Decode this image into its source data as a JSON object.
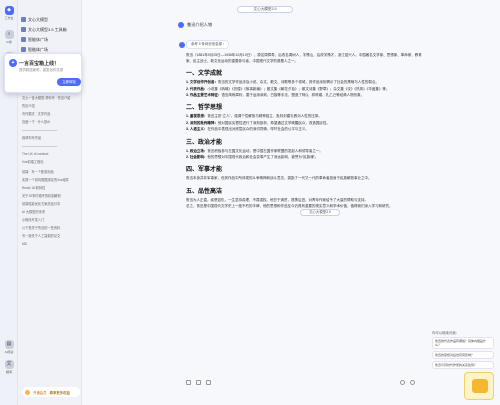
{
  "rail": {
    "items": [
      {
        "label": "工作台"
      },
      {
        "label": "AI搜"
      },
      {
        "label": "AI写作"
      },
      {
        "label": "AI阅读"
      },
      {
        "label": "翻译"
      }
    ]
  },
  "sidebar": {
    "nav": [
      {
        "label": "文心大模型",
        "icon": "chat-icon"
      },
      {
        "label": "文心大模型3.5 工具箱",
        "icon": "tool-icon"
      },
      {
        "label": "智能体广场",
        "icon": "agent-icon"
      },
      {
        "label": "智能体广场",
        "icon": "agent-icon"
      }
    ],
    "history": [
      "文心一言大模型 帮你写 · 鲁迅介绍",
      "鲁迅介绍",
      "写作模式 · 文学作品",
      "百度一下 · 什么是AI",
      "———————————",
      "我帮你写作品",
      "———————————",
      "The UX of conduct",
      "Vue前端工程化",
      "前端 · 写一个登录页面",
      "实现一个双向数据绑定的Vue组件",
      "React 18 新特性",
      "关于JS事件循环的机制解析",
      "前端性能优化方案总结分享",
      "AI 大模型的未来",
      "小程序开发入门",
      "以下是关于鲁迅的一些资料",
      "写一篇关于人工智能的论文",
      "MD"
    ],
    "popup": {
      "title": "一言百宝箱上线！",
      "subtitle": "提供精选案例，激发创作灵感",
      "button": "立即体验"
    },
    "bottom": {
      "text": "开通会员",
      "vip": "尊享更多权益"
    }
  },
  "main": {
    "top_pill": "文心大模型3.5",
    "user_prompt": "鲁迅介绍人物",
    "search_chip": "参考 8 条网页信息源 ›",
    "intro": "鲁迅（1881年9月25日—1936年10月19日），原名周樟寿，后改名周树人，字豫山，后改字豫才，浙江绍兴人。中国著名文学家、思想家、革命家、教育家、民主战士，新文化运动的重要参与者，中国现代文学的奠基人之一。",
    "sections": [
      {
        "title": "一、文学成就",
        "bullets": [
          {
            "k": "1. 文学创作开创者：",
            "v": "鲁迅的文学作品涉及小说、杂文、散文、诗歌等多个领域，其作品深刻揭示了社会的黑暗与人性的弱点。"
          },
          {
            "k": "2. 代表作品：",
            "v": "小说集《呐喊》《彷徨》《故事新编》；散文集《朝花夕拾》；散文诗集《野草》；杂文集《坟》《热风》《华盖集》等。"
          },
          {
            "k": "3. 作品主要艺术特征：",
            "v": "语言简练犀利，善于运用讽刺、白描等手法，塑造了阿Q、祥林嫂、孔乙己等经典人物形象。"
          }
        ]
      },
      {
        "title": "二、哲学思想",
        "bullets": [
          {
            "k": "1. 重视思想：",
            "v": "鲁迅主张“立人”，强调个性解放与精神独立，批判封建礼教对人性的压抑。"
          },
          {
            "k": "2. 深刻的批判精神：",
            "v": "他对国民劣根性进行了深刻剖析，希望通过文学唤醒民众，改造国民性。"
          },
          {
            "k": "3. 人道主义：",
            "v": "在作品中表现出对底层民众的深切同情，呼吁社会的公平与正义。"
          }
        ]
      },
      {
        "title": "三、政治才能",
        "bullets": [
          {
            "k": "1. 政治立场：",
            "v": "鲁迅积极参与左翼文化运动，是中国左翼作家联盟的发起人和领导者之一。"
          },
          {
            "k": "2. 社会影响：",
            "v": "他的思想对中国现代政治和社会变革产生了深远影响，被誉为“民族魂”。"
          }
        ]
      },
      {
        "title": "四、军事才能",
        "bullets": [
          {
            "k": "",
            "v": "鲁迅本身并非军事家，但其作品中所体现的斗争精神和战斗意志，激励了一代又一代的革命者投身于民族解放事业之中。"
          }
        ]
      },
      {
        "title": "五、品性高洁",
        "bullets": [
          {
            "k": "",
            "v": "鲁迅为人正直，疾恶如仇，一生坚持真理，不畏强权。他甘于清贫，提携后进，对青年作家给予了大量的帮助与支持。"
          },
          {
            "k": "",
            "v": "总之，鲁迅是中国现代文学史上一座不朽的丰碑，他的思想和作品至今仍具有重要的现实意义和学术价值，值得我们深入学习和研究。"
          }
        ]
      }
    ],
    "floating_pill": "文心大模型3.5",
    "suggest_title": "你可以继续问我：",
    "suggestions": [
      "鲁迅的代表作品有哪些？具体内容是什么？",
      "鲁迅的思想对后世有何影响？",
      "鲁迅与同时代作家的关系如何？"
    ]
  }
}
